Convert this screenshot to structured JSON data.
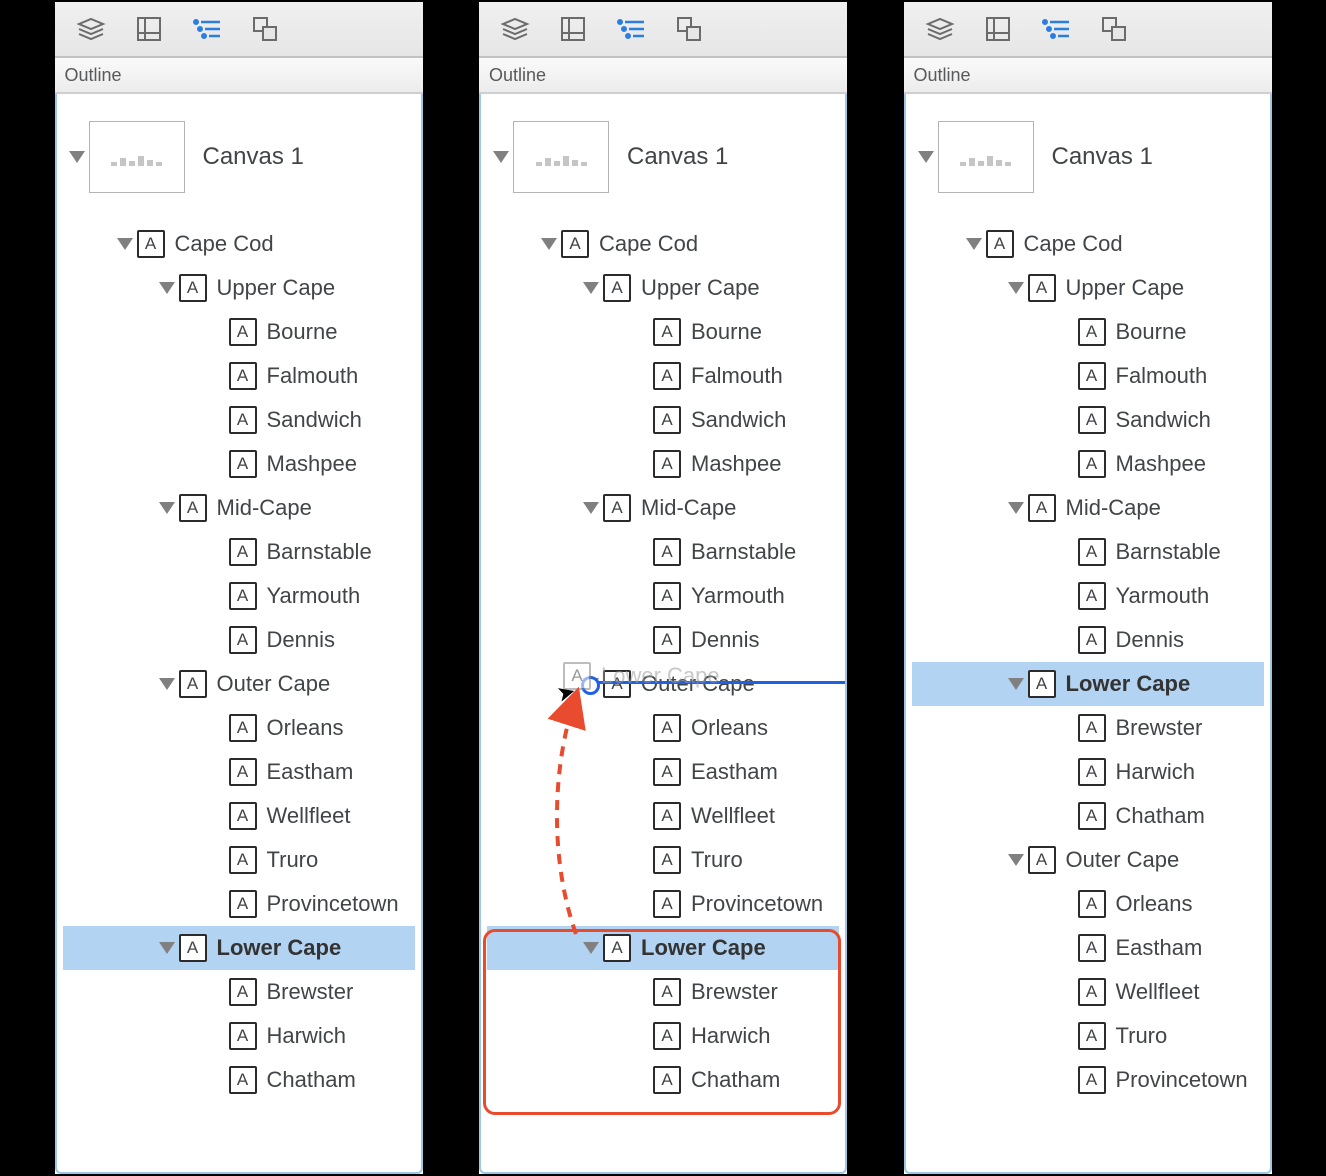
{
  "section_label": "Outline",
  "canvas_label": "Canvas 1",
  "icons": {
    "a_glyph": "A"
  },
  "arrow_color": "#e84b2d",
  "tree_before": [
    {
      "lvl": 2,
      "label": "Cape Cod",
      "disc": true
    },
    {
      "lvl": 3,
      "label": "Upper Cape",
      "disc": true
    },
    {
      "lvl": 4,
      "label": "Bourne"
    },
    {
      "lvl": 4,
      "label": "Falmouth"
    },
    {
      "lvl": 4,
      "label": "Sandwich"
    },
    {
      "lvl": 4,
      "label": "Mashpee"
    },
    {
      "lvl": 3,
      "label": "Mid-Cape",
      "disc": true
    },
    {
      "lvl": 4,
      "label": "Barnstable"
    },
    {
      "lvl": 4,
      "label": "Yarmouth"
    },
    {
      "lvl": 4,
      "label": "Dennis"
    },
    {
      "lvl": 3,
      "label": "Outer Cape",
      "disc": true
    },
    {
      "lvl": 4,
      "label": "Orleans"
    },
    {
      "lvl": 4,
      "label": "Eastham"
    },
    {
      "lvl": 4,
      "label": "Wellfleet"
    },
    {
      "lvl": 4,
      "label": "Truro"
    },
    {
      "lvl": 4,
      "label": "Provincetown"
    },
    {
      "lvl": 3,
      "label": "Lower Cape",
      "disc": true,
      "sel": true
    },
    {
      "lvl": 4,
      "label": "Brewster"
    },
    {
      "lvl": 4,
      "label": "Harwich"
    },
    {
      "lvl": 4,
      "label": "Chatham"
    }
  ],
  "drag_ghost_label": "Lower Cape",
  "tree_after": [
    {
      "lvl": 2,
      "label": "Cape Cod",
      "disc": true
    },
    {
      "lvl": 3,
      "label": "Upper Cape",
      "disc": true
    },
    {
      "lvl": 4,
      "label": "Bourne"
    },
    {
      "lvl": 4,
      "label": "Falmouth"
    },
    {
      "lvl": 4,
      "label": "Sandwich"
    },
    {
      "lvl": 4,
      "label": "Mashpee"
    },
    {
      "lvl": 3,
      "label": "Mid-Cape",
      "disc": true
    },
    {
      "lvl": 4,
      "label": "Barnstable"
    },
    {
      "lvl": 4,
      "label": "Yarmouth"
    },
    {
      "lvl": 4,
      "label": "Dennis"
    },
    {
      "lvl": 3,
      "label": "Lower Cape",
      "disc": true,
      "sel": true
    },
    {
      "lvl": 4,
      "label": "Brewster"
    },
    {
      "lvl": 4,
      "label": "Harwich"
    },
    {
      "lvl": 4,
      "label": "Chatham"
    },
    {
      "lvl": 3,
      "label": "Outer Cape",
      "disc": true
    },
    {
      "lvl": 4,
      "label": "Orleans"
    },
    {
      "lvl": 4,
      "label": "Eastham"
    },
    {
      "lvl": 4,
      "label": "Wellfleet"
    },
    {
      "lvl": 4,
      "label": "Truro"
    },
    {
      "lvl": 4,
      "label": "Provincetown"
    }
  ]
}
